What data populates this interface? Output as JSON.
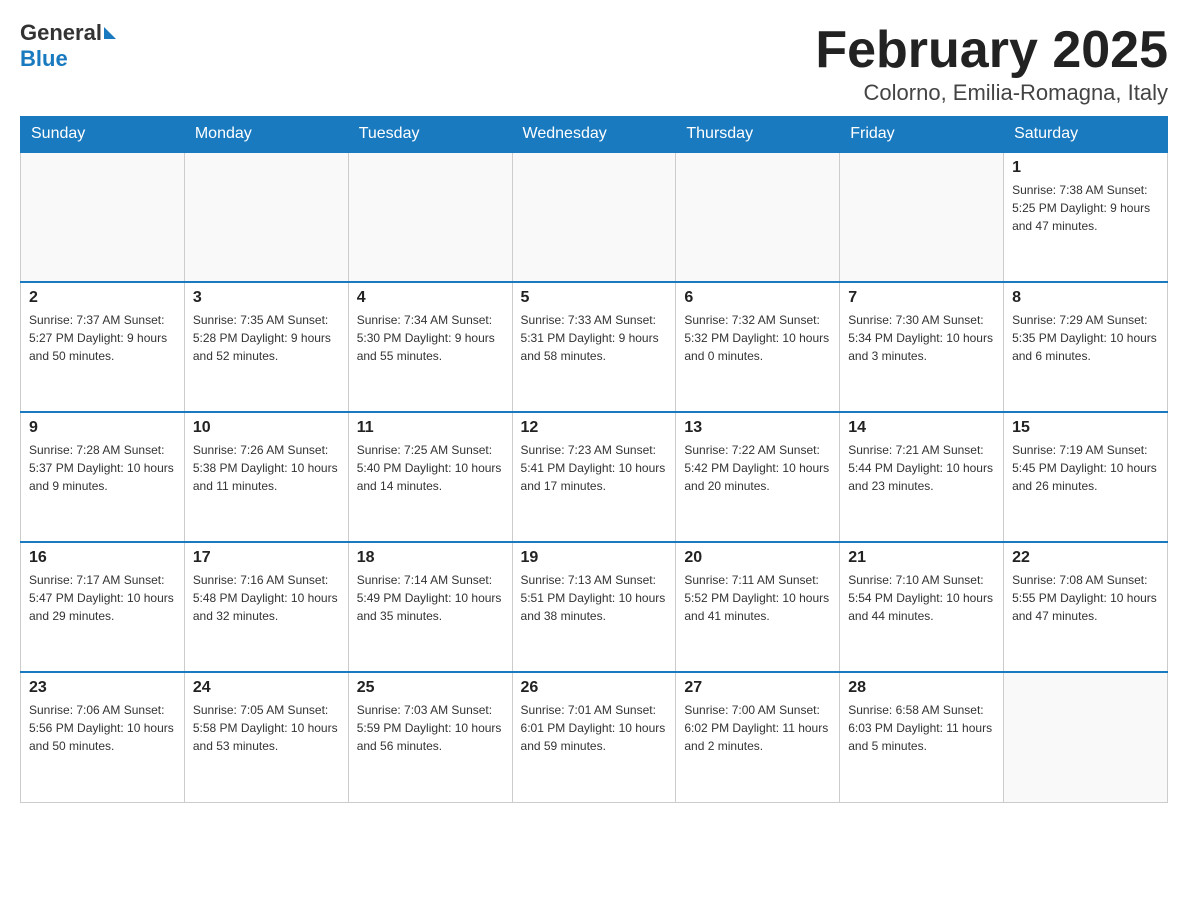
{
  "logo": {
    "general": "General",
    "blue": "Blue"
  },
  "header": {
    "title": "February 2025",
    "subtitle": "Colorno, Emilia-Romagna, Italy"
  },
  "weekdays": [
    "Sunday",
    "Monday",
    "Tuesday",
    "Wednesday",
    "Thursday",
    "Friday",
    "Saturday"
  ],
  "weeks": [
    [
      {
        "day": "",
        "info": ""
      },
      {
        "day": "",
        "info": ""
      },
      {
        "day": "",
        "info": ""
      },
      {
        "day": "",
        "info": ""
      },
      {
        "day": "",
        "info": ""
      },
      {
        "day": "",
        "info": ""
      },
      {
        "day": "1",
        "info": "Sunrise: 7:38 AM\nSunset: 5:25 PM\nDaylight: 9 hours and 47 minutes."
      }
    ],
    [
      {
        "day": "2",
        "info": "Sunrise: 7:37 AM\nSunset: 5:27 PM\nDaylight: 9 hours and 50 minutes."
      },
      {
        "day": "3",
        "info": "Sunrise: 7:35 AM\nSunset: 5:28 PM\nDaylight: 9 hours and 52 minutes."
      },
      {
        "day": "4",
        "info": "Sunrise: 7:34 AM\nSunset: 5:30 PM\nDaylight: 9 hours and 55 minutes."
      },
      {
        "day": "5",
        "info": "Sunrise: 7:33 AM\nSunset: 5:31 PM\nDaylight: 9 hours and 58 minutes."
      },
      {
        "day": "6",
        "info": "Sunrise: 7:32 AM\nSunset: 5:32 PM\nDaylight: 10 hours and 0 minutes."
      },
      {
        "day": "7",
        "info": "Sunrise: 7:30 AM\nSunset: 5:34 PM\nDaylight: 10 hours and 3 minutes."
      },
      {
        "day": "8",
        "info": "Sunrise: 7:29 AM\nSunset: 5:35 PM\nDaylight: 10 hours and 6 minutes."
      }
    ],
    [
      {
        "day": "9",
        "info": "Sunrise: 7:28 AM\nSunset: 5:37 PM\nDaylight: 10 hours and 9 minutes."
      },
      {
        "day": "10",
        "info": "Sunrise: 7:26 AM\nSunset: 5:38 PM\nDaylight: 10 hours and 11 minutes."
      },
      {
        "day": "11",
        "info": "Sunrise: 7:25 AM\nSunset: 5:40 PM\nDaylight: 10 hours and 14 minutes."
      },
      {
        "day": "12",
        "info": "Sunrise: 7:23 AM\nSunset: 5:41 PM\nDaylight: 10 hours and 17 minutes."
      },
      {
        "day": "13",
        "info": "Sunrise: 7:22 AM\nSunset: 5:42 PM\nDaylight: 10 hours and 20 minutes."
      },
      {
        "day": "14",
        "info": "Sunrise: 7:21 AM\nSunset: 5:44 PM\nDaylight: 10 hours and 23 minutes."
      },
      {
        "day": "15",
        "info": "Sunrise: 7:19 AM\nSunset: 5:45 PM\nDaylight: 10 hours and 26 minutes."
      }
    ],
    [
      {
        "day": "16",
        "info": "Sunrise: 7:17 AM\nSunset: 5:47 PM\nDaylight: 10 hours and 29 minutes."
      },
      {
        "day": "17",
        "info": "Sunrise: 7:16 AM\nSunset: 5:48 PM\nDaylight: 10 hours and 32 minutes."
      },
      {
        "day": "18",
        "info": "Sunrise: 7:14 AM\nSunset: 5:49 PM\nDaylight: 10 hours and 35 minutes."
      },
      {
        "day": "19",
        "info": "Sunrise: 7:13 AM\nSunset: 5:51 PM\nDaylight: 10 hours and 38 minutes."
      },
      {
        "day": "20",
        "info": "Sunrise: 7:11 AM\nSunset: 5:52 PM\nDaylight: 10 hours and 41 minutes."
      },
      {
        "day": "21",
        "info": "Sunrise: 7:10 AM\nSunset: 5:54 PM\nDaylight: 10 hours and 44 minutes."
      },
      {
        "day": "22",
        "info": "Sunrise: 7:08 AM\nSunset: 5:55 PM\nDaylight: 10 hours and 47 minutes."
      }
    ],
    [
      {
        "day": "23",
        "info": "Sunrise: 7:06 AM\nSunset: 5:56 PM\nDaylight: 10 hours and 50 minutes."
      },
      {
        "day": "24",
        "info": "Sunrise: 7:05 AM\nSunset: 5:58 PM\nDaylight: 10 hours and 53 minutes."
      },
      {
        "day": "25",
        "info": "Sunrise: 7:03 AM\nSunset: 5:59 PM\nDaylight: 10 hours and 56 minutes."
      },
      {
        "day": "26",
        "info": "Sunrise: 7:01 AM\nSunset: 6:01 PM\nDaylight: 10 hours and 59 minutes."
      },
      {
        "day": "27",
        "info": "Sunrise: 7:00 AM\nSunset: 6:02 PM\nDaylight: 11 hours and 2 minutes."
      },
      {
        "day": "28",
        "info": "Sunrise: 6:58 AM\nSunset: 6:03 PM\nDaylight: 11 hours and 5 minutes."
      },
      {
        "day": "",
        "info": ""
      }
    ]
  ]
}
